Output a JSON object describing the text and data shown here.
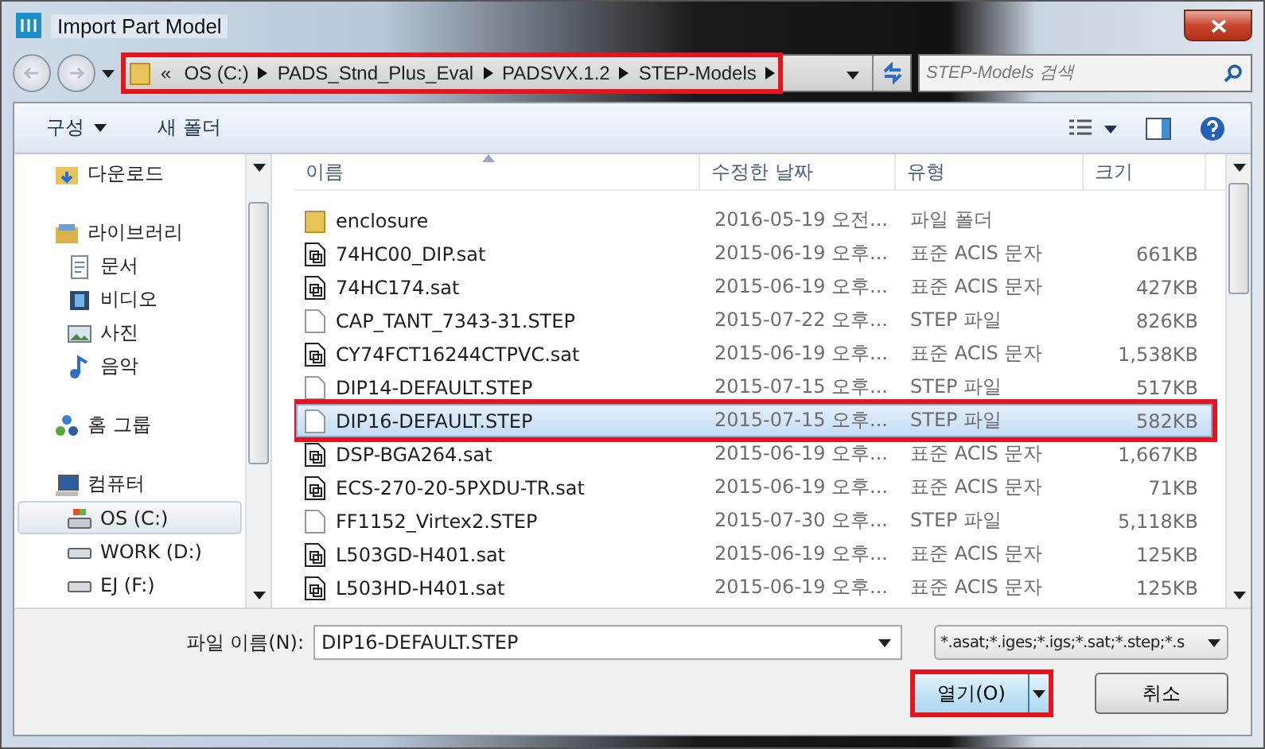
{
  "window": {
    "title": "Import Part Model"
  },
  "address": {
    "overflow": "«",
    "highlighted": true,
    "crumbs": [
      "OS (C:)",
      "PADS_Stnd_Plus_Eval",
      "PADSVX.1.2",
      "STEP-Models"
    ]
  },
  "search": {
    "placeholder": "STEP-Models 검색"
  },
  "toolbar": {
    "organize": "구성",
    "new_folder": "새 폴더"
  },
  "sidebar": {
    "items": [
      {
        "label": "다운로드",
        "kind": "download",
        "selected": false
      },
      {
        "label": "라이브러리",
        "kind": "library",
        "selected": false,
        "children": [
          {
            "label": "문서",
            "kind": "document",
            "selected": false
          },
          {
            "label": "비디오",
            "kind": "video",
            "selected": false
          },
          {
            "label": "사진",
            "kind": "picture",
            "selected": false
          },
          {
            "label": "음악",
            "kind": "music",
            "selected": false
          }
        ]
      },
      {
        "label": "홈 그룹",
        "kind": "homegroup",
        "selected": false
      },
      {
        "label": "컴퓨터",
        "kind": "computer",
        "selected": false,
        "children": [
          {
            "label": "OS (C:)",
            "kind": "system-drive",
            "selected": true
          },
          {
            "label": "WORK (D:)",
            "kind": "drive",
            "selected": false
          },
          {
            "label": "EJ (F:)",
            "kind": "drive",
            "selected": false
          }
        ]
      }
    ]
  },
  "table": {
    "columns": [
      {
        "label": "이름",
        "sorted": true
      },
      {
        "label": "수정한 날짜",
        "sorted": false
      },
      {
        "label": "유형",
        "sorted": false
      },
      {
        "label": "크기",
        "sorted": false
      }
    ],
    "rows": [
      {
        "kind": "folder",
        "name": "enclosure",
        "date": "2016-05-19 오전...",
        "type": "파일 폴더",
        "selected": false,
        "highlighted": false
      },
      {
        "kind": "sat",
        "name": "74HC00_DIP.sat",
        "date": "2015-06-19 오후...",
        "type": "표준 ACIS 문자",
        "size": "661KB",
        "selected": false,
        "highlighted": false
      },
      {
        "kind": "sat",
        "name": "74HC174.sat",
        "date": "2015-06-19 오후...",
        "type": "표준 ACIS 문자",
        "size": "427KB",
        "selected": false,
        "highlighted": false
      },
      {
        "kind": "step",
        "name": "CAP_TANT_7343-31.STEP",
        "date": "2015-07-22 오후...",
        "type": "STEP 파일",
        "size": "826KB",
        "selected": false,
        "highlighted": false
      },
      {
        "kind": "sat",
        "name": "CY74FCT16244CTPVC.sat",
        "date": "2015-06-19 오후...",
        "type": "표준 ACIS 문자",
        "size": "1,538KB",
        "selected": false,
        "highlighted": false
      },
      {
        "kind": "step",
        "name": "DIP14-DEFAULT.STEP",
        "date": "2015-07-15 오후...",
        "type": "STEP 파일",
        "size": "517KB",
        "selected": false,
        "highlighted": false
      },
      {
        "kind": "step",
        "name": "DIP16-DEFAULT.STEP",
        "date": "2015-07-15 오후...",
        "type": "STEP 파일",
        "size": "582KB",
        "selected": true,
        "highlighted": true
      },
      {
        "kind": "sat",
        "name": "DSP-BGA264.sat",
        "date": "2015-06-19 오후...",
        "type": "표준 ACIS 문자",
        "size": "1,667KB",
        "selected": false,
        "highlighted": false
      },
      {
        "kind": "sat",
        "name": "ECS-270-20-5PXDU-TR.sat",
        "date": "2015-06-19 오후...",
        "type": "표준 ACIS 문자",
        "size": "71KB",
        "selected": false,
        "highlighted": false
      },
      {
        "kind": "step",
        "name": "FF1152_Virtex2.STEP",
        "date": "2015-07-30 오후...",
        "type": "STEP 파일",
        "size": "5,118KB",
        "selected": false,
        "highlighted": false
      },
      {
        "kind": "sat",
        "name": "L503GD-H401.sat",
        "date": "2015-06-19 오후...",
        "type": "표준 ACIS 문자",
        "size": "125KB",
        "selected": false,
        "highlighted": false
      },
      {
        "kind": "sat",
        "name": "L503HD-H401.sat",
        "date": "2015-06-19 오후...",
        "type": "표준 ACIS 문자",
        "size": "125KB",
        "selected": false,
        "highlighted": false
      }
    ]
  },
  "footer": {
    "file_name_label": "파일 이름(N):",
    "file_name": "DIP16-DEFAULT.STEP",
    "filter": "*.asat;*.iges;*.igs;*.sat;*.step;*.s",
    "open": {
      "label": "열기(O)",
      "highlighted": true
    },
    "cancel": "취소"
  }
}
